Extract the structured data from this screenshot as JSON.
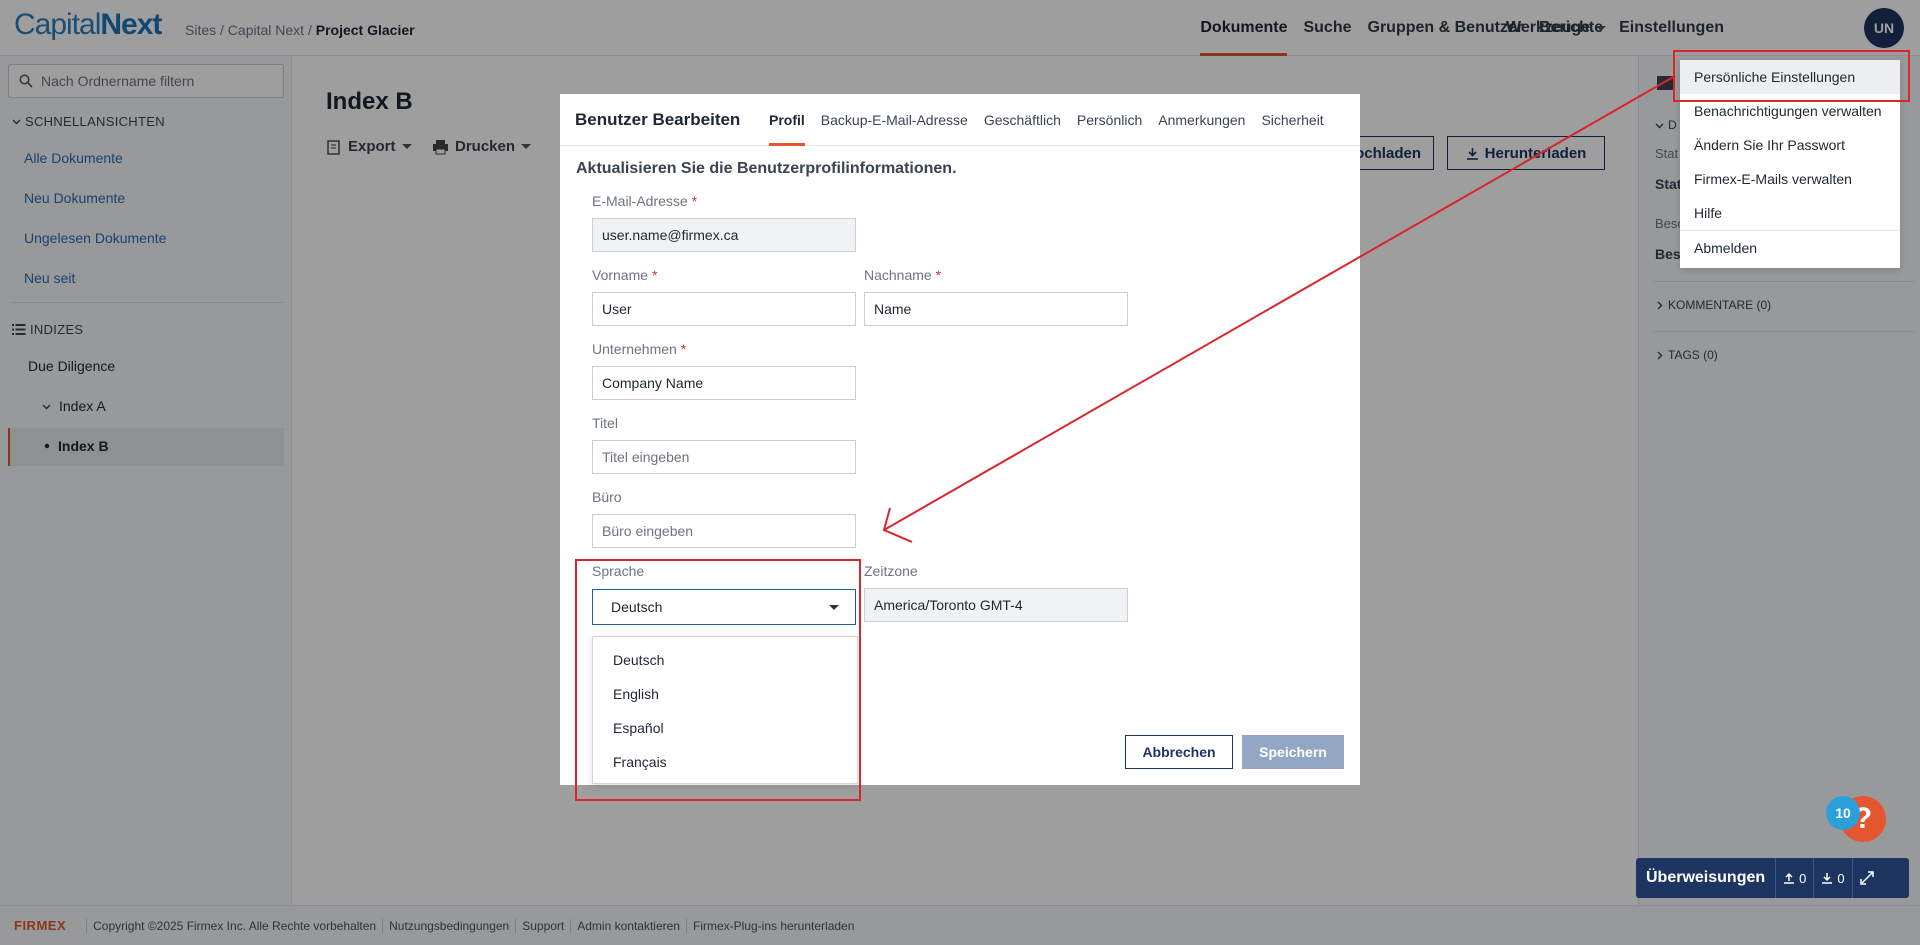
{
  "app": {
    "logo_a": "Capital",
    "logo_b": "Next"
  },
  "breadcrumb": {
    "sites": "Sites",
    "sep1": "/",
    "capital": "Capital Next",
    "sep2": "/",
    "project": "Project Glacier"
  },
  "topnav": {
    "items": [
      "Dokumente",
      "Suche",
      "Gruppen & Benutzer",
      "Berichte",
      "Einstellungen"
    ],
    "tools": "Werkzeuge",
    "avatar": "UN"
  },
  "sidebar": {
    "filter_placeholder": "Nach Ordnername filtern",
    "quick_title": "SCHNELLANSICHTEN",
    "quick_links": [
      "Alle Dokumente",
      "Neu Dokumente",
      "Ungelesen Dokumente",
      "Neu seit"
    ],
    "index_title": "INDIZES",
    "tree": {
      "root": "Due Diligence",
      "child_a": "Index A",
      "child_b": "Index B"
    }
  },
  "main": {
    "title": "Index B",
    "export": "Export",
    "print": "Drucken",
    "upload": "ochladen",
    "download": "Herunterladen"
  },
  "rightpanel": {
    "sta1": "Stat",
    "sta2": "Stat",
    "bes1": "Besc",
    "bes2": "Besc",
    "d": "D",
    "comments": "KOMMENTARE (0)",
    "tags": "TAGS (0)"
  },
  "modal": {
    "title": "Benutzer Bearbeiten",
    "tabs": [
      "Profil",
      "Backup-E-Mail-Adresse",
      "Geschäftlich",
      "Persönlich",
      "Anmerkungen",
      "Sicherheit"
    ],
    "subtitle": "Aktualisieren Sie die Benutzerprofilinformationen.",
    "required_mark": "*",
    "fields": {
      "email_label": "E-Mail-Adresse",
      "email_value": "user.name@firmex.ca",
      "first_label": "Vorname",
      "first_value": "User",
      "last_label": "Nachname",
      "last_value": "Name",
      "company_label": "Unternehmen",
      "company_value": "Company Name",
      "title_label": "Titel",
      "title_placeholder": "Titel eingeben",
      "office_label": "Büro",
      "office_placeholder": "Büro eingeben",
      "language_label": "Sprache",
      "language_value": "Deutsch",
      "timezone_label": "Zeitzone",
      "timezone_value": "America/Toronto  GMT-4"
    },
    "language_options": [
      "Deutsch",
      "English",
      "Español",
      "Français"
    ],
    "cancel": "Abbrechen",
    "save": "Speichern"
  },
  "usermenu": {
    "items": [
      "Persönliche Einstellungen",
      "Benachrichtigungen verwalten",
      "Ändern Sie Ihr Passwort",
      "Firmex-E-Mails verwalten",
      "Hilfe"
    ],
    "logout": "Abmelden"
  },
  "widgets": {
    "help_badge": "10",
    "help": "?",
    "transfers": "Überweisungen",
    "up_count": "0",
    "down_count": "0"
  },
  "footer": {
    "brand": "FIRMEX",
    "links": [
      "Copyright ©2025 Firmex Inc. Alle Rechte vorbehalten",
      "Nutzungsbedingungen",
      "Support",
      "Admin kontaktieren",
      "Firmex-Plug-ins herunterladen"
    ]
  },
  "colors": {
    "accent": "#e4572e",
    "navy": "#1e3461",
    "link": "#2a6bb4",
    "annotation": "#d8262c"
  }
}
